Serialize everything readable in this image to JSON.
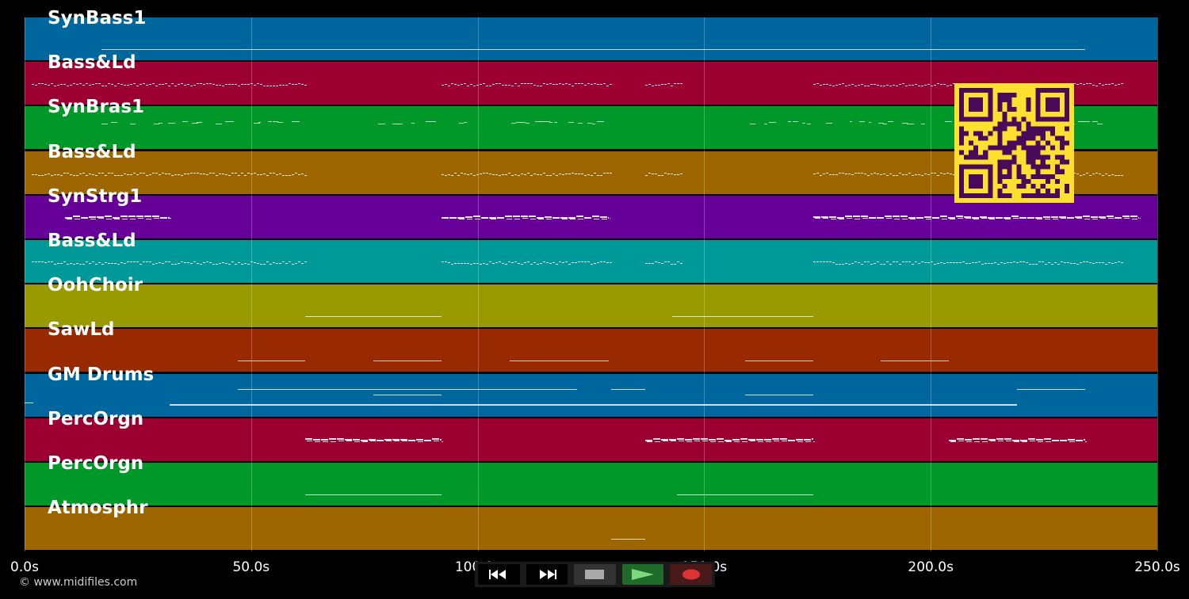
{
  "player": {
    "copyright": "© www.midifiles.com",
    "duration_seconds": 250,
    "axis_ticks": [
      "0.0s",
      "50.0s",
      "100.0s",
      "150.0s",
      "200.0s",
      "250.0s"
    ],
    "tick_values": [
      0,
      50,
      100,
      150,
      200,
      250
    ]
  },
  "transport": {
    "buttons": [
      {
        "name": "rewind-button",
        "icon": "rewind-icon",
        "bg": "#000000"
      },
      {
        "name": "fast-forward-button",
        "icon": "fast-forward-icon",
        "bg": "#000000"
      },
      {
        "name": "stop-button",
        "icon": "stop-icon",
        "bg": "#333333"
      },
      {
        "name": "play-button",
        "icon": "play-icon",
        "bg": "#1e6b2a"
      },
      {
        "name": "record-button",
        "icon": "record-icon",
        "bg": "#4a1a1a"
      }
    ]
  },
  "colors": {
    "qr_fg": "#4a0a5a",
    "qr_bg": "#ffe030"
  },
  "tracks": [
    {
      "label": "SynBass1",
      "color": "#00669e",
      "segments": [
        [
          17,
          234
        ]
      ],
      "style": "line"
    },
    {
      "label": "Bass&Ld",
      "color": "#9c0033",
      "segments": [
        [
          1.5,
          62
        ],
        [
          92,
          129.5
        ],
        [
          137,
          145
        ],
        [
          174,
          242
        ]
      ],
      "style": "dense"
    },
    {
      "label": "SynBras1",
      "color": "#009929",
      "segments": [
        [
          17,
          62
        ],
        [
          77,
          128
        ],
        [
          159,
          238
        ]
      ],
      "style": "sparse"
    },
    {
      "label": "Bass&Ld",
      "color": "#9e6600",
      "segments": [
        [
          1.5,
          62
        ],
        [
          92,
          129.5
        ],
        [
          137,
          145
        ],
        [
          174,
          242
        ]
      ],
      "style": "dense"
    },
    {
      "label": "SynStrg1",
      "color": "#660099",
      "segments": [
        [
          9,
          32
        ],
        [
          92,
          129
        ],
        [
          174,
          246
        ]
      ],
      "style": "thick"
    },
    {
      "label": "Bass&Ld",
      "color": "#009999",
      "segments": [
        [
          1.5,
          62
        ],
        [
          92,
          129.5
        ],
        [
          137,
          145
        ],
        [
          174,
          242
        ]
      ],
      "style": "dense"
    },
    {
      "label": "OohChoir",
      "color": "#999900",
      "segments": [
        [
          62,
          92
        ],
        [
          143,
          174
        ]
      ],
      "style": "line"
    },
    {
      "label": "SawLd",
      "color": "#992900",
      "segments": [
        [
          47,
          62
        ],
        [
          77,
          92
        ],
        [
          107,
          129
        ],
        [
          159,
          174
        ],
        [
          189,
          204
        ]
      ],
      "style": "line"
    },
    {
      "label": "GM Drums",
      "color": "#00669e",
      "segments": [
        [
          0,
          2
        ],
        [
          32,
          219
        ],
        [
          47,
          122
        ],
        [
          77,
          92
        ],
        [
          129.5,
          137
        ],
        [
          159,
          174
        ],
        [
          219,
          234
        ]
      ],
      "style": "drums"
    },
    {
      "label": "PercOrgn",
      "color": "#9c0033",
      "segments": [
        [
          62,
          92
        ],
        [
          137,
          174
        ],
        [
          204,
          234
        ]
      ],
      "style": "thick"
    },
    {
      "label": "PercOrgn",
      "color": "#009929",
      "segments": [
        [
          62,
          92
        ],
        [
          144,
          174
        ]
      ],
      "style": "line"
    },
    {
      "label": "Atmosphr",
      "color": "#9e6600",
      "segments": [
        [
          129.5,
          137
        ]
      ],
      "style": "line"
    }
  ]
}
